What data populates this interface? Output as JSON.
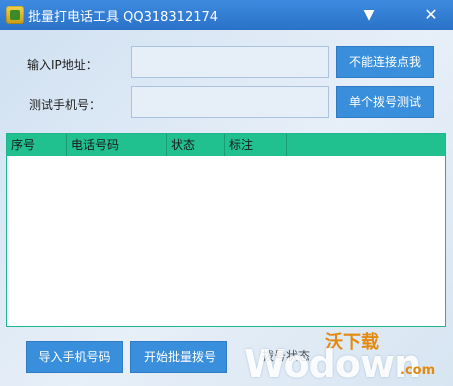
{
  "window": {
    "title": "批量打电话工具 QQ318312174",
    "minimize_glyph": "▼",
    "close_glyph": "✕"
  },
  "form": {
    "ip_label": "输入IP地址：",
    "ip_value": "",
    "phone_label": "测试手机号：",
    "phone_value": ""
  },
  "buttons": {
    "connect": "不能连接点我",
    "single_test": "单个拨号测试",
    "import_numbers": "导入手机号码",
    "start_batch": "开始批量拨号",
    "dial_status": "拨号状态"
  },
  "table": {
    "headers": [
      "序号",
      "电话号码",
      "状态",
      "标注"
    ],
    "rows": []
  },
  "watermark": {
    "cn": "沃下载",
    "en": "Wodown",
    "suffix": ".com"
  },
  "colors": {
    "titlebar": "#2f7fd6",
    "button": "#3a8fdc",
    "table_header": "#20c08f",
    "watermark_orange": "#e48a10"
  }
}
